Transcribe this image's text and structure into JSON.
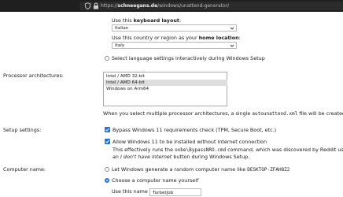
{
  "browser": {
    "url_prefix": "https://",
    "url_host": "schneegans.de",
    "url_path": "/windows/unattend-generator/"
  },
  "language": {
    "keyboard_prefix": "Use this ",
    "keyboard_bold": "keyboard layout",
    "keyboard_suffix": ":",
    "keyboard_value": "Italian",
    "home_prefix": "Use this country or region as your ",
    "home_bold": "home location",
    "home_suffix": ":",
    "home_value": "Italy",
    "interactive_label": "Select language settings interactively during Windows Setup"
  },
  "architectures": {
    "label": "Processor architectures:",
    "options": [
      "Intel / AMD 32-bit",
      "Intel / AMD 64-bit",
      "Windows on Arm64"
    ],
    "selected_index": 1,
    "note_prefix": "When you select multiple processor architectures, a single ",
    "note_code": "autounattend.xml",
    "note_suffix": " file will be created t"
  },
  "setup": {
    "label": "Setup settings:",
    "bypass_label": "Bypass Windows 11 requirements check (TPM, Secure Boot, etc.)",
    "bypass_checked": true,
    "no_internet_label": "Allow Windows 11 to be installed without internet connection",
    "no_internet_checked": true,
    "effect_prefix": "This effectively runs the ",
    "effect_code": "oobe\\BypassNRO.cmd",
    "effect_suffix": " command, which was discovered by Reddit user",
    "effect_line2_prefix": "an ",
    "effect_line2_italic": "I don't have internet",
    "effect_line2_suffix": " button during Windows Setup."
  },
  "computer_name": {
    "label": "Computer name:",
    "random_prefix": "Let Windows generate a random computer name like ",
    "random_example": "DESKTOP-ZFAH8Z2",
    "choose_label": "Choose a computer name yourself",
    "use_name_label": "Use this name",
    "name_value": "TurbetJob"
  },
  "colors": {
    "accent": "#1a73e8",
    "chrome_bg": "#1f1f1f"
  }
}
